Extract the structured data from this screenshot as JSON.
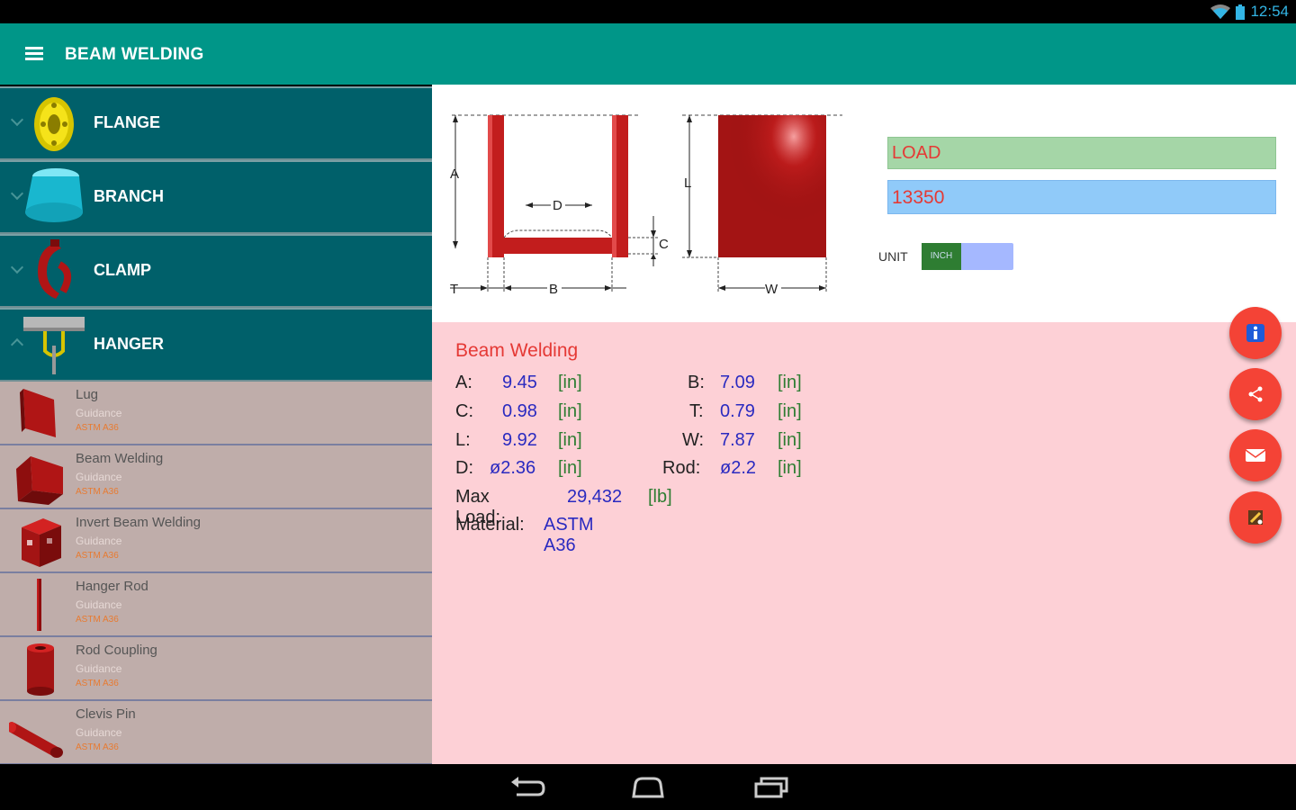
{
  "status": {
    "time": "12:54"
  },
  "appbar": {
    "title": "BEAM WELDING"
  },
  "sidebar": {
    "categories": [
      {
        "label": "FLANGE"
      },
      {
        "label": "BRANCH"
      },
      {
        "label": "CLAMP"
      },
      {
        "label": "HANGER"
      }
    ],
    "items": [
      {
        "name": "Lug",
        "guidance": "Guidance",
        "standard": "ASTM A36"
      },
      {
        "name": "Beam Welding",
        "guidance": "Guidance",
        "standard": "ASTM A36"
      },
      {
        "name": "Invert Beam Welding",
        "guidance": "Guidance",
        "standard": "ASTM A36"
      },
      {
        "name": "Hanger Rod",
        "guidance": "Guidance",
        "standard": "ASTM A36"
      },
      {
        "name": "Rod Coupling",
        "guidance": "Guidance",
        "standard": "ASTM A36"
      },
      {
        "name": "Clevis Pin",
        "guidance": "Guidance",
        "standard": "ASTM A36"
      }
    ]
  },
  "diagram": {
    "labels": {
      "A": "A",
      "D": "D",
      "C": "C",
      "T": "T",
      "B": "B",
      "L": "L",
      "W": "W"
    },
    "colors": {
      "part": "#c21d1d",
      "part_dark": "#8e0e0e"
    }
  },
  "form": {
    "load_label": "LOAD",
    "load_value": "13350",
    "unit_label": "UNIT",
    "unit_value": "INCH"
  },
  "result": {
    "title": "Beam Welding",
    "A": {
      "key": "A:",
      "value": "9.45",
      "unit": "[in]"
    },
    "B": {
      "key": "B:",
      "value": "7.09",
      "unit": "[in]"
    },
    "C": {
      "key": "C:",
      "value": "0.98",
      "unit": "[in]"
    },
    "T": {
      "key": "T:",
      "value": "0.79",
      "unit": "[in]"
    },
    "L": {
      "key": "L:",
      "value": "9.92",
      "unit": "[in]"
    },
    "W": {
      "key": "W:",
      "value": "7.87",
      "unit": "[in]"
    },
    "D": {
      "key": "D:",
      "value": "ø2.36",
      "unit": "[in]"
    },
    "Rod": {
      "key": "Rod:",
      "value": "ø2.2",
      "unit": "[in]"
    },
    "max_load": {
      "key": "Max Load:",
      "value": "29,432",
      "unit": "[lb]"
    },
    "material": {
      "key": "Material:",
      "value": "ASTM A36"
    }
  },
  "colors": {
    "accent": "#009688",
    "fab": "#f44336",
    "result_bg": "#fdd0d6"
  }
}
